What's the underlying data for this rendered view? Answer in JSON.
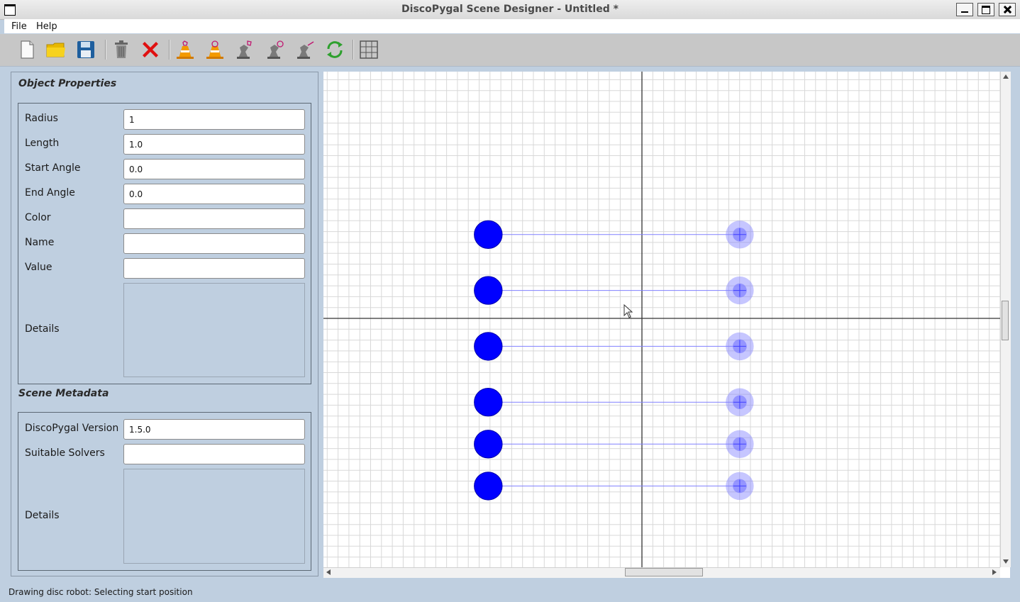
{
  "window": {
    "title": "DiscoPygal Scene Designer - Untitled *"
  },
  "menu": {
    "items": [
      "File",
      "Help"
    ]
  },
  "toolbar": {
    "buttons": [
      {
        "name": "new-scene",
        "icon": "new-file-icon"
      },
      {
        "name": "open-scene",
        "icon": "folder-icon"
      },
      {
        "name": "save-scene",
        "icon": "floppy-disk-icon"
      },
      {
        "name": "delete-selected",
        "icon": "trash-icon"
      },
      {
        "name": "clear-all",
        "icon": "red-x-icon"
      },
      {
        "name": "add-obstacle-polygon",
        "icon": "obstacle-polygon-icon"
      },
      {
        "name": "add-obstacle-disc",
        "icon": "obstacle-disc-icon"
      },
      {
        "name": "add-polygon-robot",
        "icon": "robot-polygon-icon"
      },
      {
        "name": "add-disc-robot",
        "icon": "robot-disc-icon"
      },
      {
        "name": "add-rod-robot",
        "icon": "robot-rod-icon"
      },
      {
        "name": "refresh",
        "icon": "refresh-icon"
      },
      {
        "name": "toggle-grid",
        "icon": "grid-icon"
      }
    ]
  },
  "object_properties": {
    "title": "Object Properties",
    "radius_label": "Radius",
    "radius_value": "1",
    "length_label": "Length",
    "length_value": "1.0",
    "start_angle_label": "Start Angle",
    "start_angle_value": "0.0",
    "end_angle_label": "End Angle",
    "end_angle_value": "0.0",
    "color_label": "Color",
    "color_value": "",
    "name_label": "Name",
    "name_value": "",
    "value_label": "Value",
    "value_value": "",
    "details_label": "Details"
  },
  "scene_metadata": {
    "title": "Scene Metadata",
    "version_label": "DiscoPygal Version",
    "version_value": "1.5.0",
    "solvers_label": "Suitable Solvers",
    "solvers_value": "",
    "details_label": "Details"
  },
  "canvas": {
    "robot_color": "#0000ff",
    "goal_color": "#8080ff",
    "robots": [
      {
        "start": [
          -5.5,
          3
        ],
        "goal": [
          3.5,
          3
        ]
      },
      {
        "start": [
          -5.5,
          1
        ],
        "goal": [
          3.5,
          1
        ]
      },
      {
        "start": [
          -5.5,
          -1
        ],
        "goal": [
          3.5,
          -1
        ]
      },
      {
        "start": [
          -5.5,
          -3
        ],
        "goal": [
          3.5,
          -3
        ]
      },
      {
        "start": [
          -5.5,
          -4.5
        ],
        "goal": [
          3.5,
          -4.5
        ]
      },
      {
        "start": [
          -5.5,
          -6
        ],
        "goal": [
          3.5,
          -6
        ]
      }
    ],
    "robot_radius": 1
  },
  "status": {
    "text": "Drawing disc robot: Selecting start position"
  }
}
